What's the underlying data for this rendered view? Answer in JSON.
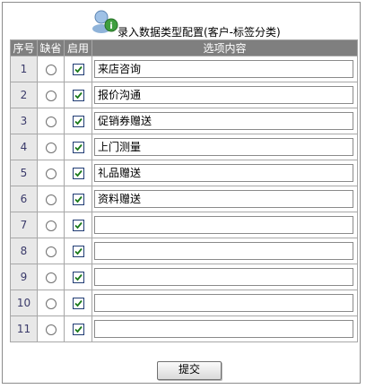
{
  "header": {
    "title": "录入数据类型配置(客户-标签分类)",
    "icon": "user-info-icon"
  },
  "table": {
    "columns": [
      "序号",
      "缺省",
      "启用",
      "选项内容"
    ],
    "rows": [
      {
        "num": "1",
        "default": false,
        "enabled": true,
        "content": "来店咨询"
      },
      {
        "num": "2",
        "default": false,
        "enabled": true,
        "content": "报价沟通"
      },
      {
        "num": "3",
        "default": false,
        "enabled": true,
        "content": "促销券赠送"
      },
      {
        "num": "4",
        "default": false,
        "enabled": true,
        "content": "上门测量"
      },
      {
        "num": "5",
        "default": false,
        "enabled": true,
        "content": "礼品赠送"
      },
      {
        "num": "6",
        "default": false,
        "enabled": true,
        "content": "资料赠送"
      },
      {
        "num": "7",
        "default": false,
        "enabled": true,
        "content": ""
      },
      {
        "num": "8",
        "default": false,
        "enabled": true,
        "content": ""
      },
      {
        "num": "9",
        "default": false,
        "enabled": true,
        "content": ""
      },
      {
        "num": "10",
        "default": false,
        "enabled": true,
        "content": ""
      },
      {
        "num": "11",
        "default": false,
        "enabled": true,
        "content": ""
      }
    ]
  },
  "buttons": {
    "submit_label": "提交"
  }
}
